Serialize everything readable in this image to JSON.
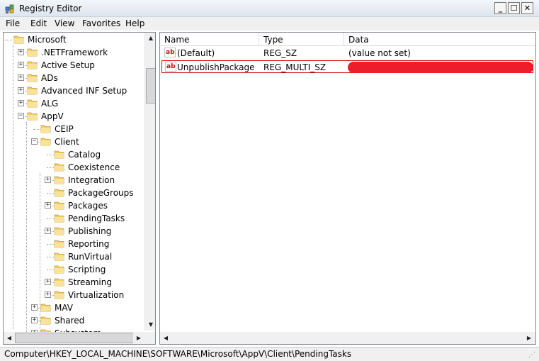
{
  "window": {
    "title": "Registry Editor",
    "min_label": "_",
    "max_label": "☐",
    "close_label": "✕"
  },
  "menu": [
    "File",
    "Edit",
    "View",
    "Favorites",
    "Help"
  ],
  "tree": [
    {
      "label": "Microsoft",
      "depth": 0,
      "expander": "",
      "open": true
    },
    {
      "label": ".NETFramework",
      "depth": 1,
      "expander": "+"
    },
    {
      "label": "Active Setup",
      "depth": 1,
      "expander": "+"
    },
    {
      "label": "ADs",
      "depth": 1,
      "expander": "+"
    },
    {
      "label": "Advanced INF Setup",
      "depth": 1,
      "expander": "+"
    },
    {
      "label": "ALG",
      "depth": 1,
      "expander": "+"
    },
    {
      "label": "AppV",
      "depth": 1,
      "expander": "−",
      "open": true
    },
    {
      "label": "CEIP",
      "depth": 2,
      "expander": ""
    },
    {
      "label": "Client",
      "depth": 2,
      "expander": "−",
      "open": true
    },
    {
      "label": "Catalog",
      "depth": 3,
      "expander": ""
    },
    {
      "label": "Coexistence",
      "depth": 3,
      "expander": ""
    },
    {
      "label": "Integration",
      "depth": 3,
      "expander": "+"
    },
    {
      "label": "PackageGroups",
      "depth": 3,
      "expander": ""
    },
    {
      "label": "Packages",
      "depth": 3,
      "expander": "+"
    },
    {
      "label": "PendingTasks",
      "depth": 3,
      "expander": "",
      "selected": true
    },
    {
      "label": "Publishing",
      "depth": 3,
      "expander": "+"
    },
    {
      "label": "Reporting",
      "depth": 3,
      "expander": ""
    },
    {
      "label": "RunVirtual",
      "depth": 3,
      "expander": ""
    },
    {
      "label": "Scripting",
      "depth": 3,
      "expander": ""
    },
    {
      "label": "Streaming",
      "depth": 3,
      "expander": "+"
    },
    {
      "label": "Virtualization",
      "depth": 3,
      "expander": "+"
    },
    {
      "label": "MAV",
      "depth": 2,
      "expander": "+"
    },
    {
      "label": "Shared",
      "depth": 2,
      "expander": "+"
    },
    {
      "label": "Subsystem",
      "depth": 2,
      "expander": "+"
    }
  ],
  "columns": {
    "name": "Name",
    "type": "Type",
    "data": "Data"
  },
  "values": [
    {
      "name": "(Default)",
      "type": "REG_SZ",
      "data": "(value not set)",
      "icon": "string-value-icon"
    },
    {
      "name": "UnpublishPackage",
      "type": "REG_MULTI_SZ",
      "data": "",
      "icon": "string-value-icon",
      "selected": true,
      "redacted": true
    }
  ],
  "icon_text": "ab",
  "status": {
    "path": "Computer\\HKEY_LOCAL_MACHINE\\SOFTWARE\\Microsoft\\AppV\\Client\\PendingTasks"
  },
  "colors": {
    "redaction": "#ee1d2a",
    "selection_border": "#d10b0b",
    "folder": "#f3d06c"
  }
}
